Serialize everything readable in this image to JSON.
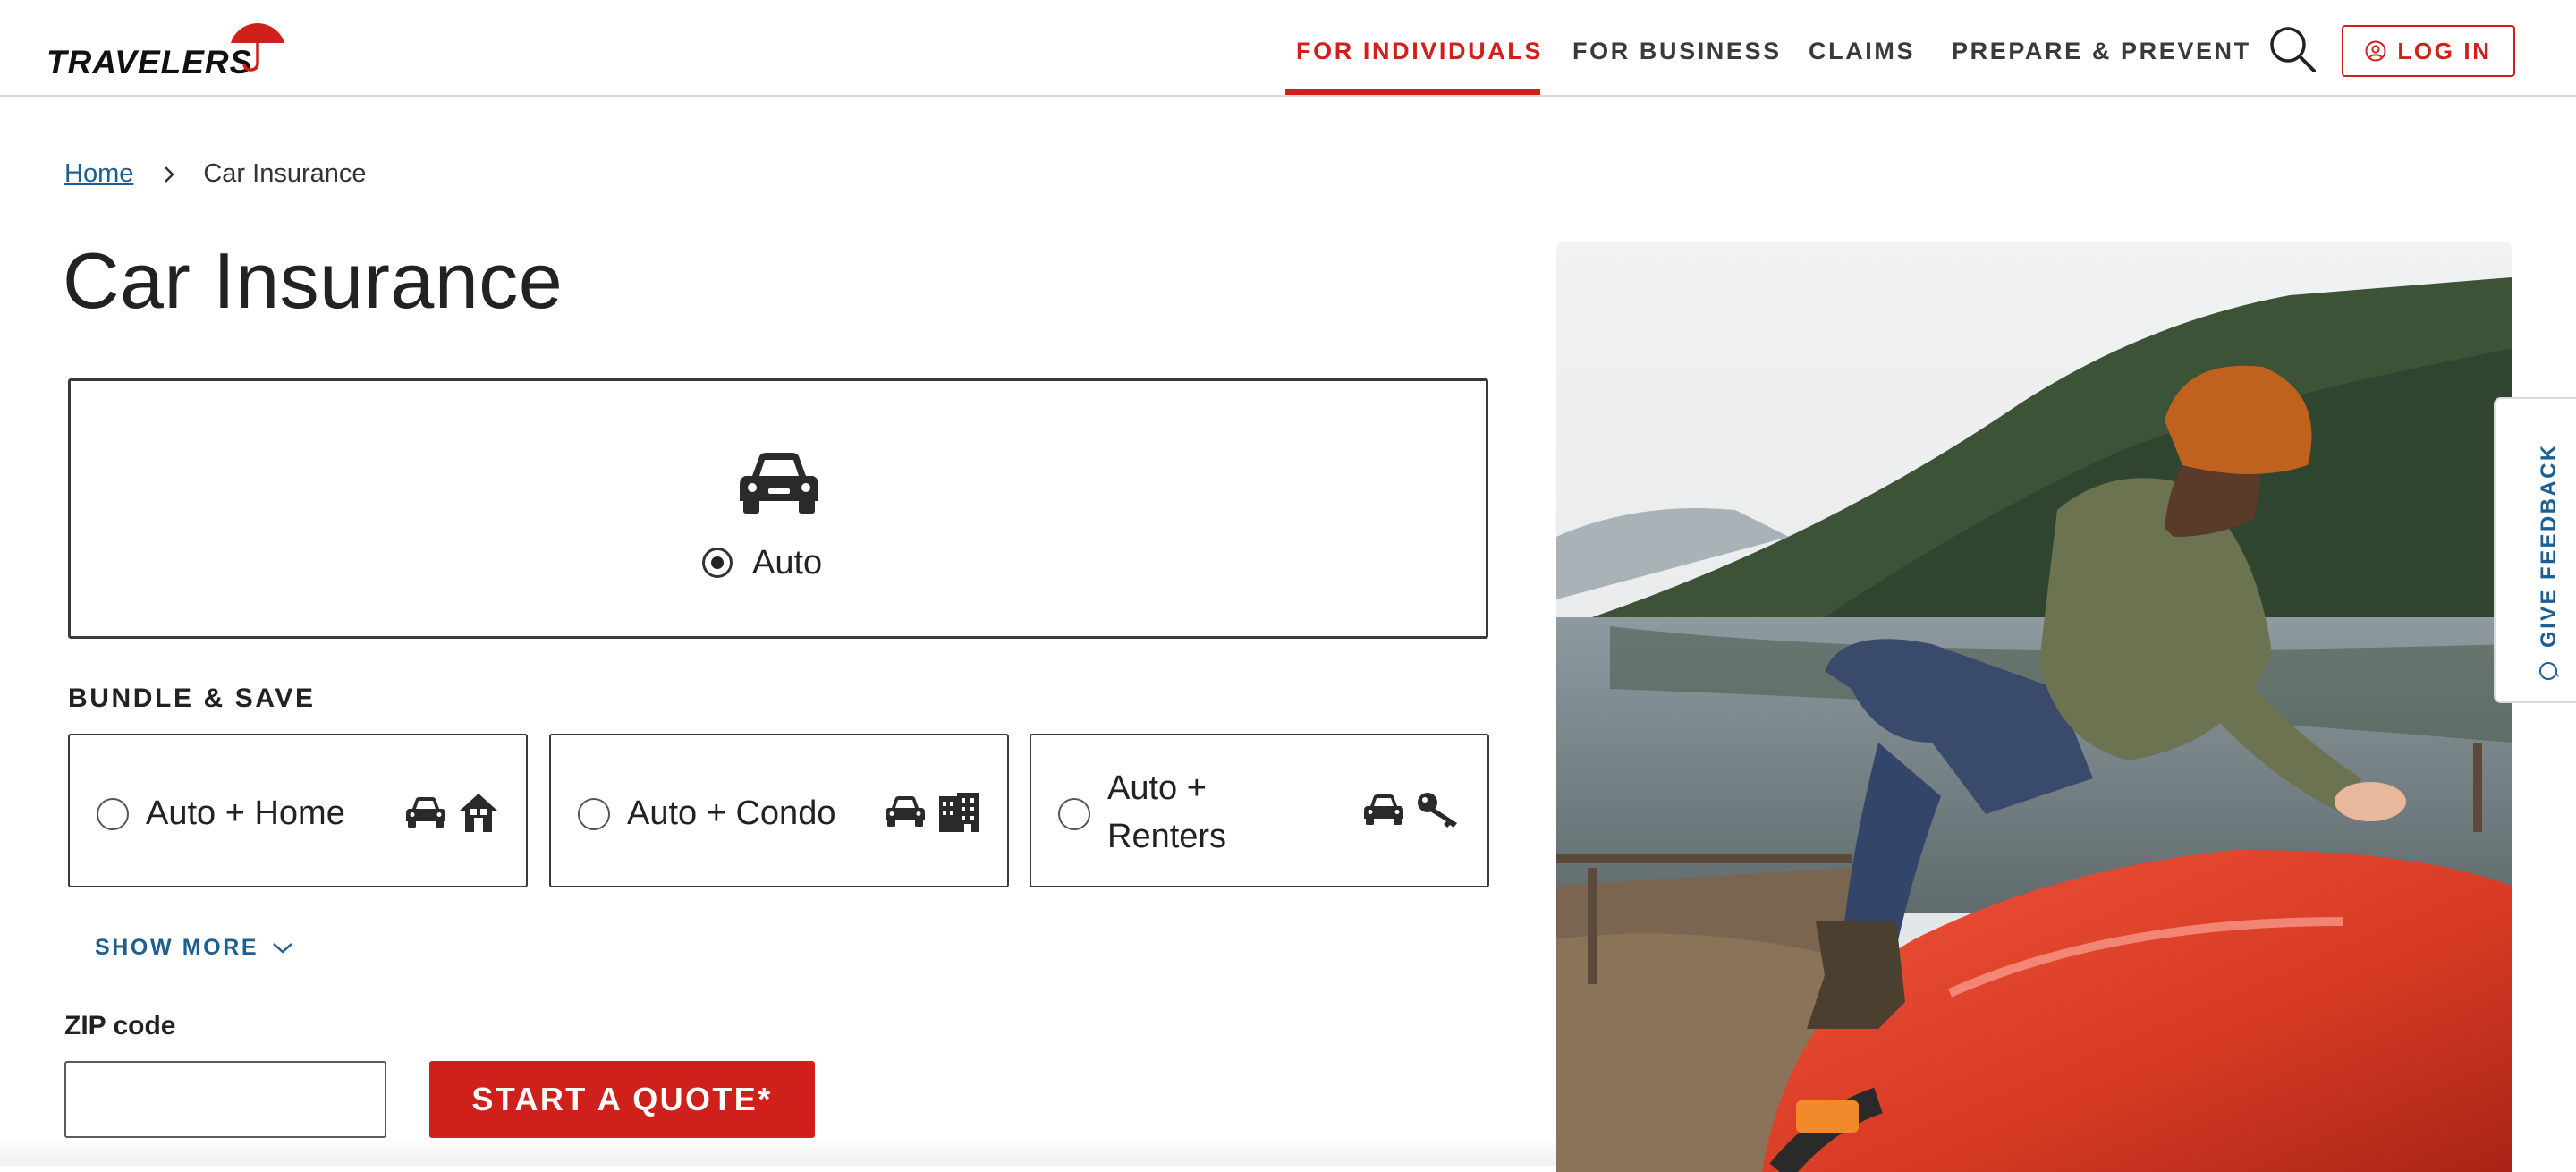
{
  "header": {
    "logo_text": "TRAVELERS",
    "nav": [
      {
        "label": "FOR INDIVIDUALS",
        "active": true
      },
      {
        "label": "FOR BUSINESS"
      },
      {
        "label": "CLAIMS"
      },
      {
        "label": "PREPARE & PREVENT"
      }
    ],
    "search_icon": "search-icon",
    "login_label": "LOG IN"
  },
  "breadcrumb": {
    "home": "Home",
    "current": "Car Insurance"
  },
  "page_title": "Car Insurance",
  "product_selector": {
    "selected_label": "Auto",
    "icon": "car-icon",
    "selected": true
  },
  "bundle": {
    "heading": "BUNDLE & SAVE",
    "options": [
      {
        "label": "Auto + Home",
        "icons": [
          "car-icon",
          "house-icon"
        ]
      },
      {
        "label": "Auto + Condo",
        "icons": [
          "car-icon",
          "building-icon"
        ]
      },
      {
        "label_line1": "Auto +",
        "label_line2": "Renters",
        "icons": [
          "car-icon",
          "key-icon"
        ]
      }
    ],
    "show_more": "SHOW MORE"
  },
  "quote_form": {
    "zip_label": "ZIP code",
    "zip_value": "",
    "button_label": "START A QUOTE*"
  },
  "feedback_tab": "GIVE FEEDBACK",
  "colors": {
    "brand_red": "#d0201c",
    "link_blue": "#1c5f90"
  }
}
